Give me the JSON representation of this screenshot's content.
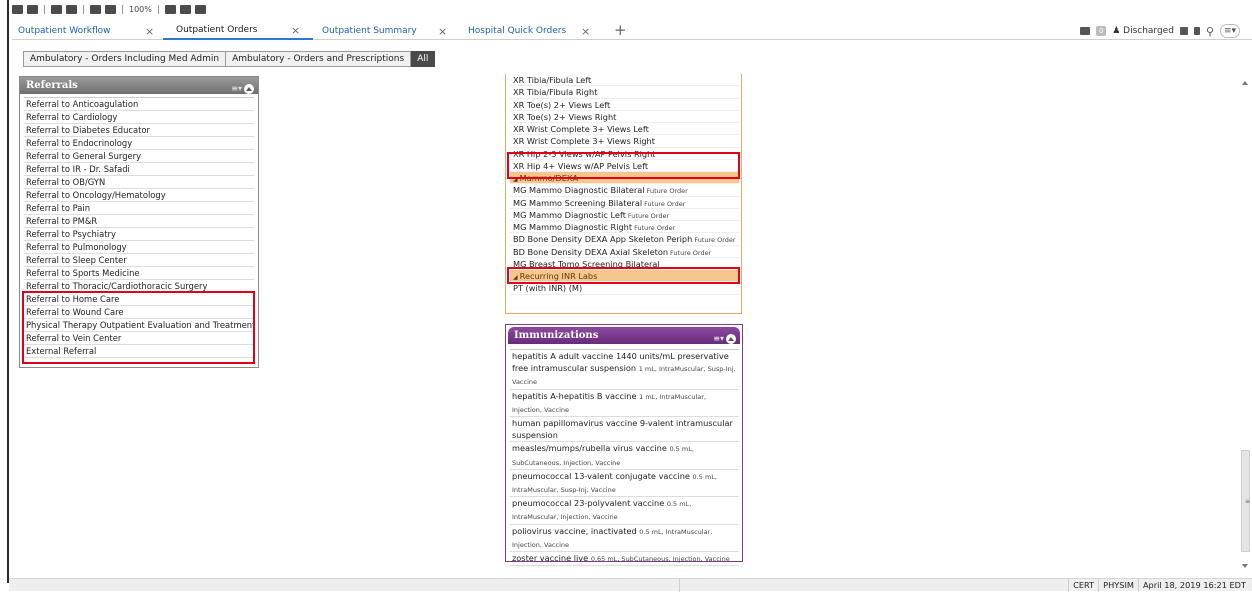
{
  "toolbar": {
    "zoom": "100%"
  },
  "tabs": [
    {
      "label": "Outpatient Workflow"
    },
    {
      "label": "Outpatient Orders"
    },
    {
      "label": "Outpatient Summary"
    },
    {
      "label": "Hospital Quick Orders"
    }
  ],
  "header_right": {
    "badge_count": "0",
    "status": "Discharged"
  },
  "filters": [
    "Ambulatory - Orders Including Med Admin",
    "Ambulatory - Orders and Prescriptions",
    "All"
  ],
  "referrals": {
    "title": "Referrals",
    "items": [
      "Referral to Anticoagulation",
      "Referral to Cardiology",
      "Referral to Diabetes Educator",
      "Referral to Endocrinology",
      "Referral to General Surgery",
      "Referral to IR - Dr. Safadi",
      "Referral to OB/GYN",
      "Referral to Oncology/Hematology",
      "Referral to Pain",
      "Referral to PM&R",
      "Referral to Psychiatry",
      "Referral to Pulmonology",
      "Referral to Sleep Center",
      "Referral to Sports Medicine",
      "Referral to Thoracic/Cardiothoracic Surgery",
      "Referral to Home Care",
      "Referral to Wound Care",
      "Physical Therapy Outpatient Evaluation and Treatment",
      "Referral to Vein Center",
      "External Referral"
    ]
  },
  "orders": {
    "items": [
      {
        "name": "XR Tibia/Fibula Left",
        "note": ""
      },
      {
        "name": "XR Tibia/Fibula Right",
        "note": ""
      },
      {
        "name": "XR Toe(s) 2+ Views Left",
        "note": ""
      },
      {
        "name": "XR Toe(s) 2+ Views Right",
        "note": ""
      },
      {
        "name": "XR Wrist Complete 3+ Views Left",
        "note": ""
      },
      {
        "name": "XR Wrist Complete 3+ Views Right",
        "note": ""
      },
      {
        "name": "XR Hip 2-3 Views w/AP Pelvis Right",
        "note": ""
      },
      {
        "name": "XR Hip 4+ Views w/AP Pelvis Left",
        "note": ""
      },
      {
        "name": "Mammo/DEXA",
        "note": ""
      },
      {
        "name": "MG Mammo Diagnostic Bilateral",
        "note": "Future Order"
      },
      {
        "name": "MG Mammo Screening Bilateral",
        "note": "Future Order"
      },
      {
        "name": "MG Mammo Diagnostic Left",
        "note": "Future Order"
      },
      {
        "name": "MG Mammo Diagnostic Right",
        "note": "Future Order"
      },
      {
        "name": "BD Bone Density DEXA App Skeleton Periph",
        "note": "Future Order"
      },
      {
        "name": "BD Bone Density DEXA Axial Skeleton",
        "note": "Future Order"
      },
      {
        "name": "MG Breast Tomo Screening Bilateral",
        "note": ""
      },
      {
        "name": "Recurring INR Labs",
        "note": ""
      },
      {
        "name": "PT (with INR) (M)",
        "note": ""
      }
    ]
  },
  "immunizations": {
    "title": "Immunizations",
    "items": [
      {
        "name": "hepatitis A adult vaccine 1440 units/mL preservative free intramuscular suspension",
        "detail": "1 mL, IntraMuscular, Susp-Inj, Vaccine"
      },
      {
        "name": "hepatitis A-hepatitis B vaccine",
        "detail": "1 mL, IntraMuscular, Injection, Vaccine"
      },
      {
        "name": "human papillomavirus vaccine 9-valent intramuscular suspension",
        "detail": ""
      },
      {
        "name": "measles/mumps/rubella virus vaccine",
        "detail": "0.5 mL, SubCutaneous, Injection, Vaccine"
      },
      {
        "name": "pneumococcal 13-valent conjugate vaccine",
        "detail": "0.5 mL, IntraMuscular, Susp-Inj, Vaccine"
      },
      {
        "name": "pneumococcal 23-polyvalent vaccine",
        "detail": "0.5 mL, IntraMuscular, Injection, Vaccine"
      },
      {
        "name": "poliovirus vaccine, inactivated",
        "detail": "0.5 mL, IntraMuscular, Injection, Vaccine"
      },
      {
        "name": "zoster vaccine live",
        "detail": "0.65 mL, SubCutaneous, Injection, Vaccine"
      }
    ]
  },
  "status_bar": {
    "env": "CERT",
    "user": "PHYSIM",
    "datetime": "April 18, 2019  16:21 EDT"
  }
}
